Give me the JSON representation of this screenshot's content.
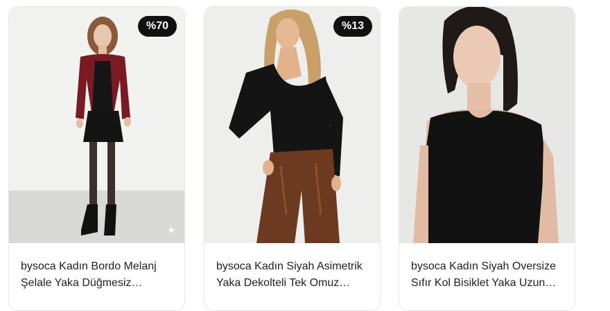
{
  "products": [
    {
      "discount": "%70",
      "title": "bysoca Kadın Bordo Melanj Şelale Yaka Düğmesiz…",
      "image": "woman-burgundy-cardigan-black-skirt"
    },
    {
      "discount": "%13",
      "title": "bysoca Kadın Siyah Asimetrik Yaka Dekolteli Tek Omuz…",
      "image": "woman-black-asymmetric-top-brown-leather-pants"
    },
    {
      "discount": "",
      "title": "bysoca Kadın Siyah Oversize Sıfır Kol Bisiklet Yaka Uzun…",
      "image": "woman-black-sleeveless-top"
    }
  ],
  "colors": {
    "badge_bg": "#111111",
    "badge_text": "#ffffff",
    "title_text": "#1f1f1f"
  },
  "icons": [
    "sparkle-icon"
  ]
}
